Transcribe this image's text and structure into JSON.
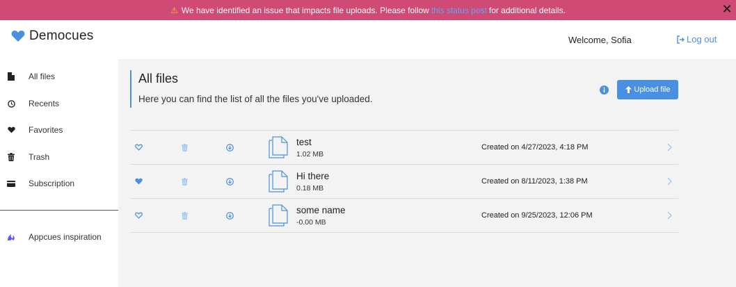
{
  "banner": {
    "text_before": "We have identified an issue that impacts file uploads. Please follow",
    "link_text": "this status post",
    "text_after": "for additional details.",
    "warning_icon": "warning-icon",
    "close_label": "✕"
  },
  "header": {
    "brand": "Democues",
    "welcome": "Welcome, Sofia",
    "logout_label": "Log out"
  },
  "sidebar": {
    "items": [
      {
        "label": "All files",
        "icon": "file-icon"
      },
      {
        "label": "Recents",
        "icon": "clock-icon"
      },
      {
        "label": "Favorites",
        "icon": "heart-icon"
      },
      {
        "label": "Trash",
        "icon": "trash-icon"
      },
      {
        "label": "Subscription",
        "icon": "credit-card-icon"
      }
    ],
    "extra_items": [
      {
        "label": "Appcues inspiration",
        "icon": "appcues-icon"
      }
    ]
  },
  "main": {
    "title": "All files",
    "subtitle": "Here you can find the list of all the files you've uploaded.",
    "upload_label": "Upload file"
  },
  "files": [
    {
      "name": "test",
      "size": "1.02 MB",
      "created": "Created on 4/27/2023, 4:18 PM",
      "favorite": false
    },
    {
      "name": "Hi there",
      "size": "0.18 MB",
      "created": "Created on 8/11/2023, 1:38 PM",
      "favorite": true
    },
    {
      "name": "some name",
      "size": "-0.00 MB",
      "created": "Created on 9/25/2023, 12:06 PM",
      "favorite": false
    }
  ],
  "colors": {
    "banner": "#cf4a74",
    "accent": "#4a90e2",
    "main_bg": "#f3f3f4"
  }
}
